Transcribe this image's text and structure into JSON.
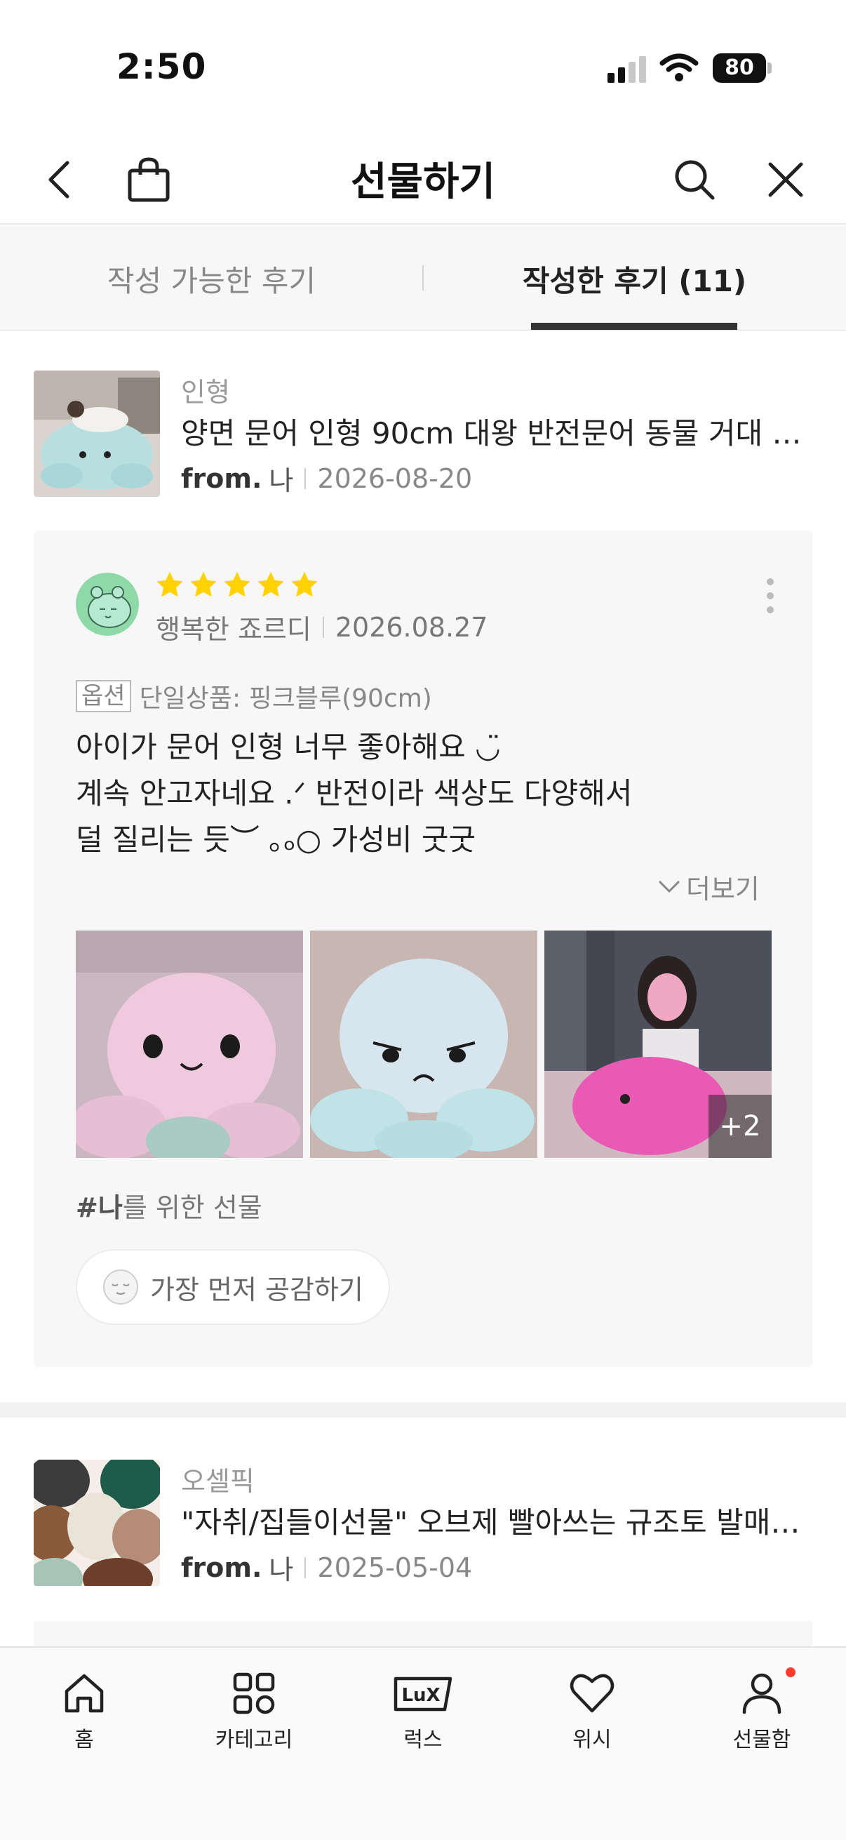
{
  "status_bar": {
    "time": "2:50",
    "battery": "80"
  },
  "header": {
    "title": "선물하기"
  },
  "tabs": [
    {
      "label": "작성 가능한 후기",
      "active": false
    },
    {
      "label": "작성한 후기 (11)",
      "active": true
    }
  ],
  "products": [
    {
      "category": "인형",
      "title": "양면 문어 인형 90cm 대왕 반전문어 동물 거대 …",
      "from_label": "from.",
      "from_name": "나",
      "date": "2026-08-20"
    },
    {
      "category": "오셀픽",
      "title": "\"자취/집들이선물\" 오브제 빨아쓰는 규조토 발매…",
      "from_label": "from.",
      "from_name": "나",
      "date": "2025-05-04"
    }
  ],
  "review": {
    "rating": 5,
    "reviewer": "행복한 죠르디",
    "date": "2026.08.27",
    "option_tag": "옵션",
    "option_value": "단일상품: 핑크블루(90cm)",
    "lines": [
      "아이가 문어 인형 너무 좋아해요 ◡̈",
      "계속 안고자네요 .ᐟ 반전이라 색상도 다양해서",
      "덜 질리는 듯︶ ｡ₒ○ 가성비 굿굿"
    ],
    "see_more": "더보기",
    "photo_more": "+2",
    "hashtag_bold": "#나",
    "hashtag_rest": "를 위한 선물",
    "empathy": "가장 먼저 공감하기"
  },
  "bottom_nav": [
    {
      "label": "홈",
      "icon": "home-icon"
    },
    {
      "label": "카테고리",
      "icon": "category-grid-icon"
    },
    {
      "label": "럭스",
      "icon": "lux-icon"
    },
    {
      "label": "위시",
      "icon": "heart-icon"
    },
    {
      "label": "선물함",
      "icon": "person-icon"
    }
  ],
  "colors": {
    "star": "#FFD200",
    "accent_dot": "#FF3B30",
    "tab_underline": "#333333"
  }
}
